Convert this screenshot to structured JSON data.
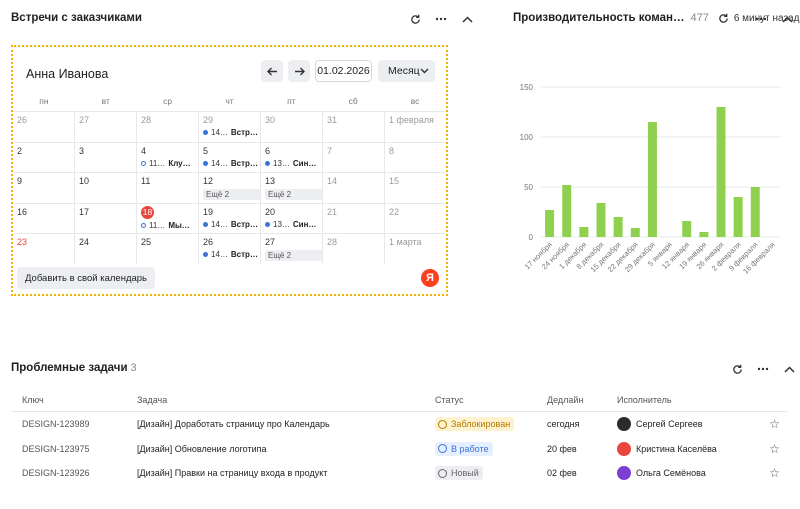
{
  "calendar_widget": {
    "title": "Встречи с заказчиками",
    "user_name": "Анна Иванова",
    "date": "01.02.2026",
    "view": "Месяц",
    "add_button": "Добавить в свой календарь",
    "logo_letter": "Я",
    "weekdays": [
      "пн",
      "вт",
      "ср",
      "чт",
      "пт",
      "сб",
      "вс"
    ],
    "weeks": [
      [
        {
          "d": "26",
          "muted": true
        },
        {
          "d": "27",
          "muted": true
        },
        {
          "d": "28",
          "muted": true
        },
        {
          "d": "29",
          "muted": true,
          "events": [
            {
              "time": "14…",
              "title": "Встр…",
              "hollow": false
            }
          ]
        },
        {
          "d": "30",
          "muted": true
        },
        {
          "d": "31",
          "muted": true
        },
        {
          "d": "1 февраля",
          "muted": true
        }
      ],
      [
        {
          "d": "2"
        },
        {
          "d": "3"
        },
        {
          "d": "4",
          "events": [
            {
              "time": "11…",
              "title": "Клу…",
              "hollow": true
            }
          ]
        },
        {
          "d": "5",
          "events": [
            {
              "time": "14…",
              "title": "Встр…",
              "hollow": false
            }
          ]
        },
        {
          "d": "6",
          "events": [
            {
              "time": "13…",
              "title": "Син…",
              "hollow": false
            }
          ]
        },
        {
          "d": "7",
          "muted": true
        },
        {
          "d": "8",
          "muted": true
        }
      ],
      [
        {
          "d": "9"
        },
        {
          "d": "10"
        },
        {
          "d": "11"
        },
        {
          "d": "12",
          "more": "Ещё 2"
        },
        {
          "d": "13",
          "more": "Ещё 2"
        },
        {
          "d": "14",
          "muted": true
        },
        {
          "d": "15",
          "muted": true
        }
      ],
      [
        {
          "d": "16"
        },
        {
          "d": "17"
        },
        {
          "d": "18",
          "today": true,
          "events": [
            {
              "time": "11…",
              "title": "Мы…",
              "hollow": true
            }
          ]
        },
        {
          "d": "19",
          "events": [
            {
              "time": "14…",
              "title": "Встр…",
              "hollow": false
            }
          ]
        },
        {
          "d": "20",
          "events": [
            {
              "time": "13…",
              "title": "Син…",
              "hollow": false
            }
          ]
        },
        {
          "d": "21",
          "muted": true
        },
        {
          "d": "22",
          "muted": true
        }
      ],
      [
        {
          "d": "23",
          "red": true
        },
        {
          "d": "24"
        },
        {
          "d": "25"
        },
        {
          "d": "26",
          "events": [
            {
              "time": "14…",
              "title": "Встр…",
              "hollow": false
            }
          ]
        },
        {
          "d": "27",
          "more": "Ещё 2"
        },
        {
          "d": "28",
          "muted": true
        },
        {
          "d": "1 марта",
          "muted": true
        }
      ]
    ]
  },
  "chart_widget": {
    "title": "Производительность коман…",
    "count": "477",
    "updated": "6 минут назад"
  },
  "chart_data": {
    "type": "bar",
    "categories": [
      "17 ноября",
      "24 ноября",
      "1 декабря",
      "8 декабря",
      "15 декабря",
      "22 декабря",
      "29 декабря",
      "5 января",
      "12 января",
      "19 января",
      "26 января",
      "2 февраля",
      "9 февраля",
      "16 февраля"
    ],
    "values": [
      27,
      52,
      10,
      34,
      20,
      9,
      115,
      0,
      16,
      5,
      130,
      40,
      50,
      0
    ],
    "ylim": [
      0,
      150
    ],
    "yticks": [
      0,
      50,
      100,
      150
    ],
    "grid": true,
    "color": "#8fd14f"
  },
  "tasks_widget": {
    "title": "Проблемные задачи",
    "count": "3",
    "columns": {
      "key": "Ключ",
      "task": "Задача",
      "status": "Статус",
      "deadline": "Дедлайн",
      "assignee": "Исполнитель"
    },
    "rows": [
      {
        "key": "DESIGN-123989",
        "task": "[Дизайн] Доработать страницу про Календарь",
        "status": "Заблокирован",
        "status_color": "#b07a00",
        "status_bg": "#fff3cf",
        "deadline": "сегодня",
        "assignee": "Сергей Сергеев",
        "avatar_color": "#2b2b2b"
      },
      {
        "key": "DESIGN-123975",
        "task": "[Дизайн] Обновление логотипа",
        "status": "В работе",
        "status_color": "#3a73d6",
        "status_bg": "#e5efff",
        "deadline": "20 фев",
        "assignee": "Кристина Каселёва",
        "avatar_color": "#e8453c"
      },
      {
        "key": "DESIGN-123926",
        "task": "[Дизайн] Правки на страницу входа в продукт",
        "status": "Новый",
        "status_color": "#666666",
        "status_bg": "#eceef1",
        "deadline": "02 фев",
        "assignee": "Ольга Семёнова",
        "avatar_color": "#7b3fd1"
      }
    ]
  }
}
